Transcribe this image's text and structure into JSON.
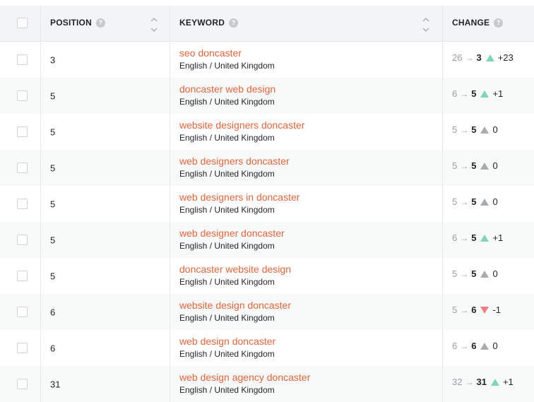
{
  "header": {
    "position_label": "POSITION",
    "keyword_label": "KEYWORD",
    "change_label": "CHANGE",
    "help_glyph": "?"
  },
  "arrow_glyph": "→",
  "colors": {
    "keyword_link": "#e8643a",
    "trend_up": "#7fd6b3",
    "trend_neutral": "#a7acb1",
    "trend_down": "#ec7f80"
  },
  "rows": [
    {
      "position": "3",
      "keyword": "seo doncaster",
      "locale": "English / United Kingdom",
      "prev": "26",
      "cur": "3",
      "trend": "up",
      "delta": "+23"
    },
    {
      "position": "5",
      "keyword": "doncaster web design",
      "locale": "English / United Kingdom",
      "prev": "6",
      "cur": "5",
      "trend": "up",
      "delta": "+1"
    },
    {
      "position": "5",
      "keyword": "website designers doncaster",
      "locale": "English / United Kingdom",
      "prev": "5",
      "cur": "5",
      "trend": "neutral",
      "delta": "0"
    },
    {
      "position": "5",
      "keyword": "web designers doncaster",
      "locale": "English / United Kingdom",
      "prev": "5",
      "cur": "5",
      "trend": "neutral",
      "delta": "0"
    },
    {
      "position": "5",
      "keyword": "web designers in doncaster",
      "locale": "English / United Kingdom",
      "prev": "5",
      "cur": "5",
      "trend": "neutral",
      "delta": "0"
    },
    {
      "position": "5",
      "keyword": "web designer doncaster",
      "locale": "English / United Kingdom",
      "prev": "6",
      "cur": "5",
      "trend": "up",
      "delta": "+1"
    },
    {
      "position": "5",
      "keyword": "doncaster website design",
      "locale": "English / United Kingdom",
      "prev": "5",
      "cur": "5",
      "trend": "neutral",
      "delta": "0"
    },
    {
      "position": "6",
      "keyword": "website design doncaster",
      "locale": "English / United Kingdom",
      "prev": "5",
      "cur": "6",
      "trend": "down",
      "delta": "-1"
    },
    {
      "position": "6",
      "keyword": "web design doncaster",
      "locale": "English / United Kingdom",
      "prev": "6",
      "cur": "6",
      "trend": "neutral",
      "delta": "0"
    },
    {
      "position": "31",
      "keyword": "web design agency doncaster",
      "locale": "English / United Kingdom",
      "prev": "32",
      "cur": "31",
      "trend": "up",
      "delta": "+1"
    }
  ]
}
